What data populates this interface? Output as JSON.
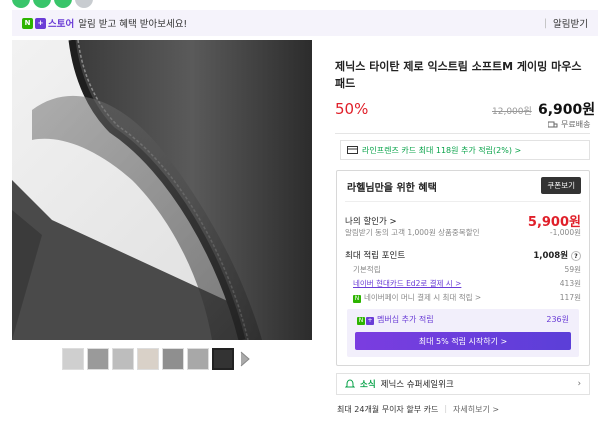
{
  "banner": {
    "store_label": "스토어",
    "badge_n": "N",
    "badge_plus": "+",
    "message": "알림 받고 혜택 받아보세요!",
    "right_label": "알림받기"
  },
  "product": {
    "title": "제닉스 타이탄 제로 익스트림 소프트M 게이밍 마우스패드",
    "discount": "50%",
    "original_price": "12,000원",
    "price": "6,900원",
    "shipping": "무료배송"
  },
  "card_promo": {
    "text": "라인프렌즈 카드 최대 118원 추가 적립(2%) >"
  },
  "coupon": {
    "title": "라헬님만을 위한 혜택",
    "button": "쿠폰보기",
    "my_price_label": "나의 할인가 >",
    "my_price_value": "5,900원",
    "alarm_label": "알림받기 동의 고객 1,000원 상품중복할인",
    "alarm_value": "-1,000원",
    "points_label": "최대 적립 포인트",
    "points_value": "1,008원",
    "basic_label": "기본적립",
    "basic_value": "59원",
    "hyundai_label": "네이버 현대카드 Ed2로 결제 시 >",
    "hyundai_value": "413원",
    "npay_label": "네이버페이 머니 결제 시 최대 적립 >",
    "npay_value": "117원",
    "membership_label": "멤버십 추가 적립",
    "membership_value": "236원",
    "membership_button": "최대 5% 적립 시작하기 >"
  },
  "news": {
    "tag": "소식",
    "text": "제닉스 슈퍼세일위크"
  },
  "installment": {
    "text": "최대 24개월 무이자 할부 카드",
    "more": "자세히보기 >"
  },
  "colors": {
    "accent_purple": "#6a3cd6",
    "naver_green": "#2db400",
    "sale_red": "#e0202a"
  }
}
